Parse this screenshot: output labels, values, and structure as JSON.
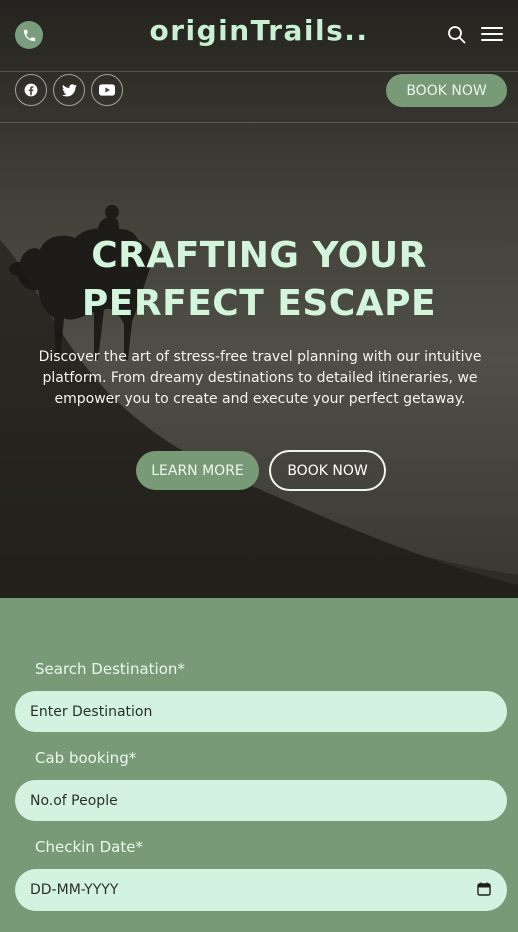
{
  "header": {
    "brand": "originTrails..",
    "book_label": "BOOK NOW",
    "icons": [
      "phone-icon",
      "search-icon",
      "hamburger-menu-icon"
    ],
    "social_icons": [
      "facebook-icon",
      "twitter-icon",
      "youtube-icon"
    ]
  },
  "hero": {
    "title_line1": "CRAFTING YOUR",
    "title_line2": "PERFECT ESCAPE",
    "description": "Discover the art of stress-free travel planning with our intuitive platform. From dreamy destinations to detailed itineraries, we empower you to create and execute your perfect getaway.",
    "learn_more_label": "LEARN MORE",
    "book_now_label": "BOOK NOW"
  },
  "form": {
    "destination_label": "Search Destination*",
    "destination_placeholder": "Enter Destination",
    "cab_label": "Cab booking*",
    "cab_placeholder": "No.of People",
    "checkin_label": "Checkin Date*",
    "checkin_placeholder": "DD-MM-YYYY"
  },
  "colors": {
    "accent_green": "#789a77",
    "brand_mint": "#c9f0d2",
    "input_bg": "#d3f3e0"
  }
}
